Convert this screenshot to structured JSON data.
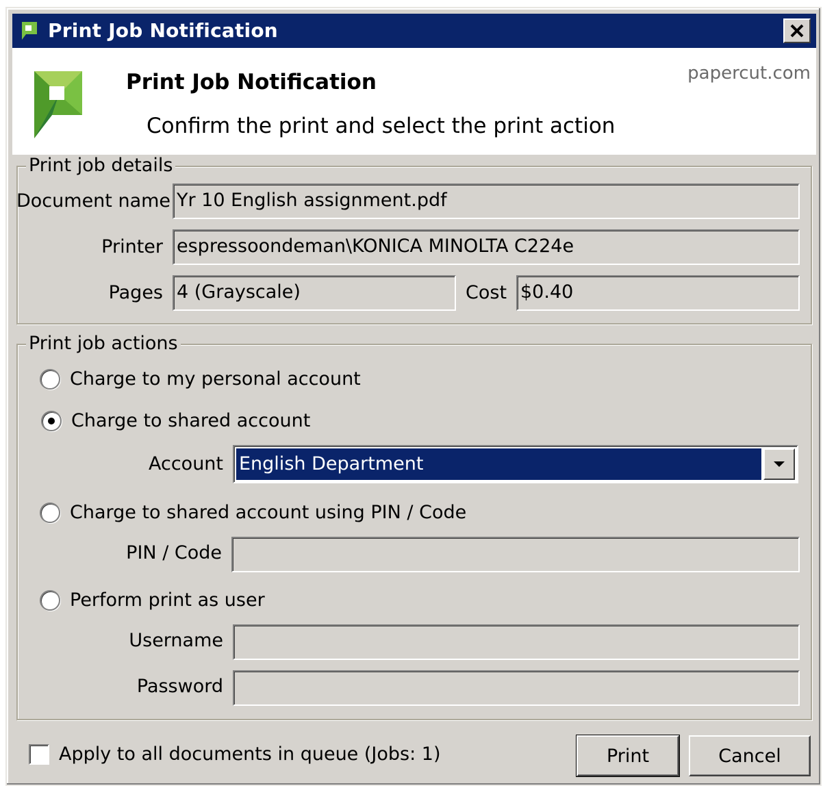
{
  "window": {
    "title": "Print Job Notification"
  },
  "header": {
    "title": "Print Job Notification",
    "subtitle": "Confirm the print and select the print action",
    "brand": "papercut.com"
  },
  "details": {
    "legend": "Print job details",
    "document_name_label": "Document name",
    "document_name_value": "Yr 10 English assignment.pdf",
    "printer_label": "Printer",
    "printer_value": "espressoondeman\\KONICA MINOLTA C224e",
    "pages_label": "Pages",
    "pages_value": "4   (Grayscale)",
    "cost_label": "Cost",
    "cost_value": "$0.40"
  },
  "actions": {
    "legend": "Print job actions",
    "options": [
      {
        "label": "Charge to my personal account",
        "checked": false
      },
      {
        "label": "Charge to shared account",
        "checked": true
      },
      {
        "label": "Charge to shared account using PIN / Code",
        "checked": false
      },
      {
        "label": "Perform print as user",
        "checked": false
      }
    ],
    "account_label": "Account",
    "account_selected": "English Department",
    "pin_label": "PIN / Code",
    "pin_value": "",
    "username_label": "Username",
    "username_value": "",
    "password_label": "Password",
    "password_value": ""
  },
  "footer": {
    "apply_all_label": "Apply to all documents in queue (Jobs: 1)",
    "apply_all_checked": false,
    "print_label": "Print",
    "cancel_label": "Cancel"
  },
  "icons": {
    "app": "papercut-logo-icon",
    "close": "close-icon",
    "dropdown": "chevron-down-icon"
  },
  "colors": {
    "titlebar": "#0a246a",
    "dialog_bg": "#d6d3ce",
    "selection": "#0a246a",
    "logo_green": "#7ac143"
  }
}
